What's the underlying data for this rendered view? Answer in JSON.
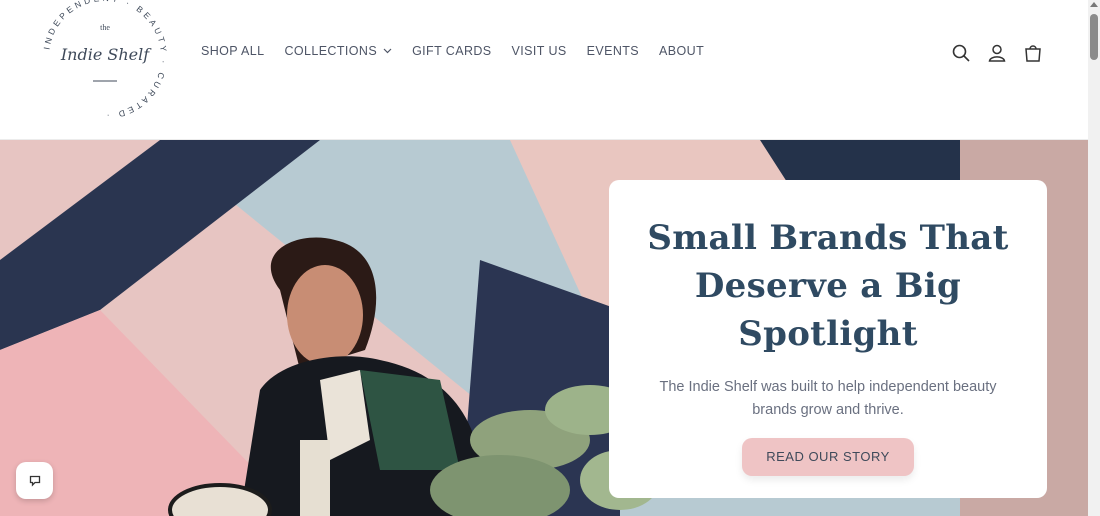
{
  "logo": {
    "name_small": "the",
    "name_main": "Indie Shelf",
    "ring_text": "INDEPENDENT · BEAUTY · CURATED ·"
  },
  "nav": {
    "items": [
      "SHOP ALL",
      "COLLECTIONS",
      "GIFT CARDS",
      "VISIT US",
      "EVENTS",
      "ABOUT"
    ]
  },
  "header_icons": [
    "search-icon",
    "account-icon",
    "cart-icon"
  ],
  "hero": {
    "title": "Small Brands That Deserve a Big Spotlight",
    "subtitle": "The Indie Shelf was built to help independent beauty brands grow and thrive.",
    "button_label": "READ OUR STORY"
  },
  "chat_icon": "chat-icon",
  "colors": {
    "title": "#2f4a62",
    "button_bg": "#efc4c5",
    "nav_text": "#4e5566"
  }
}
